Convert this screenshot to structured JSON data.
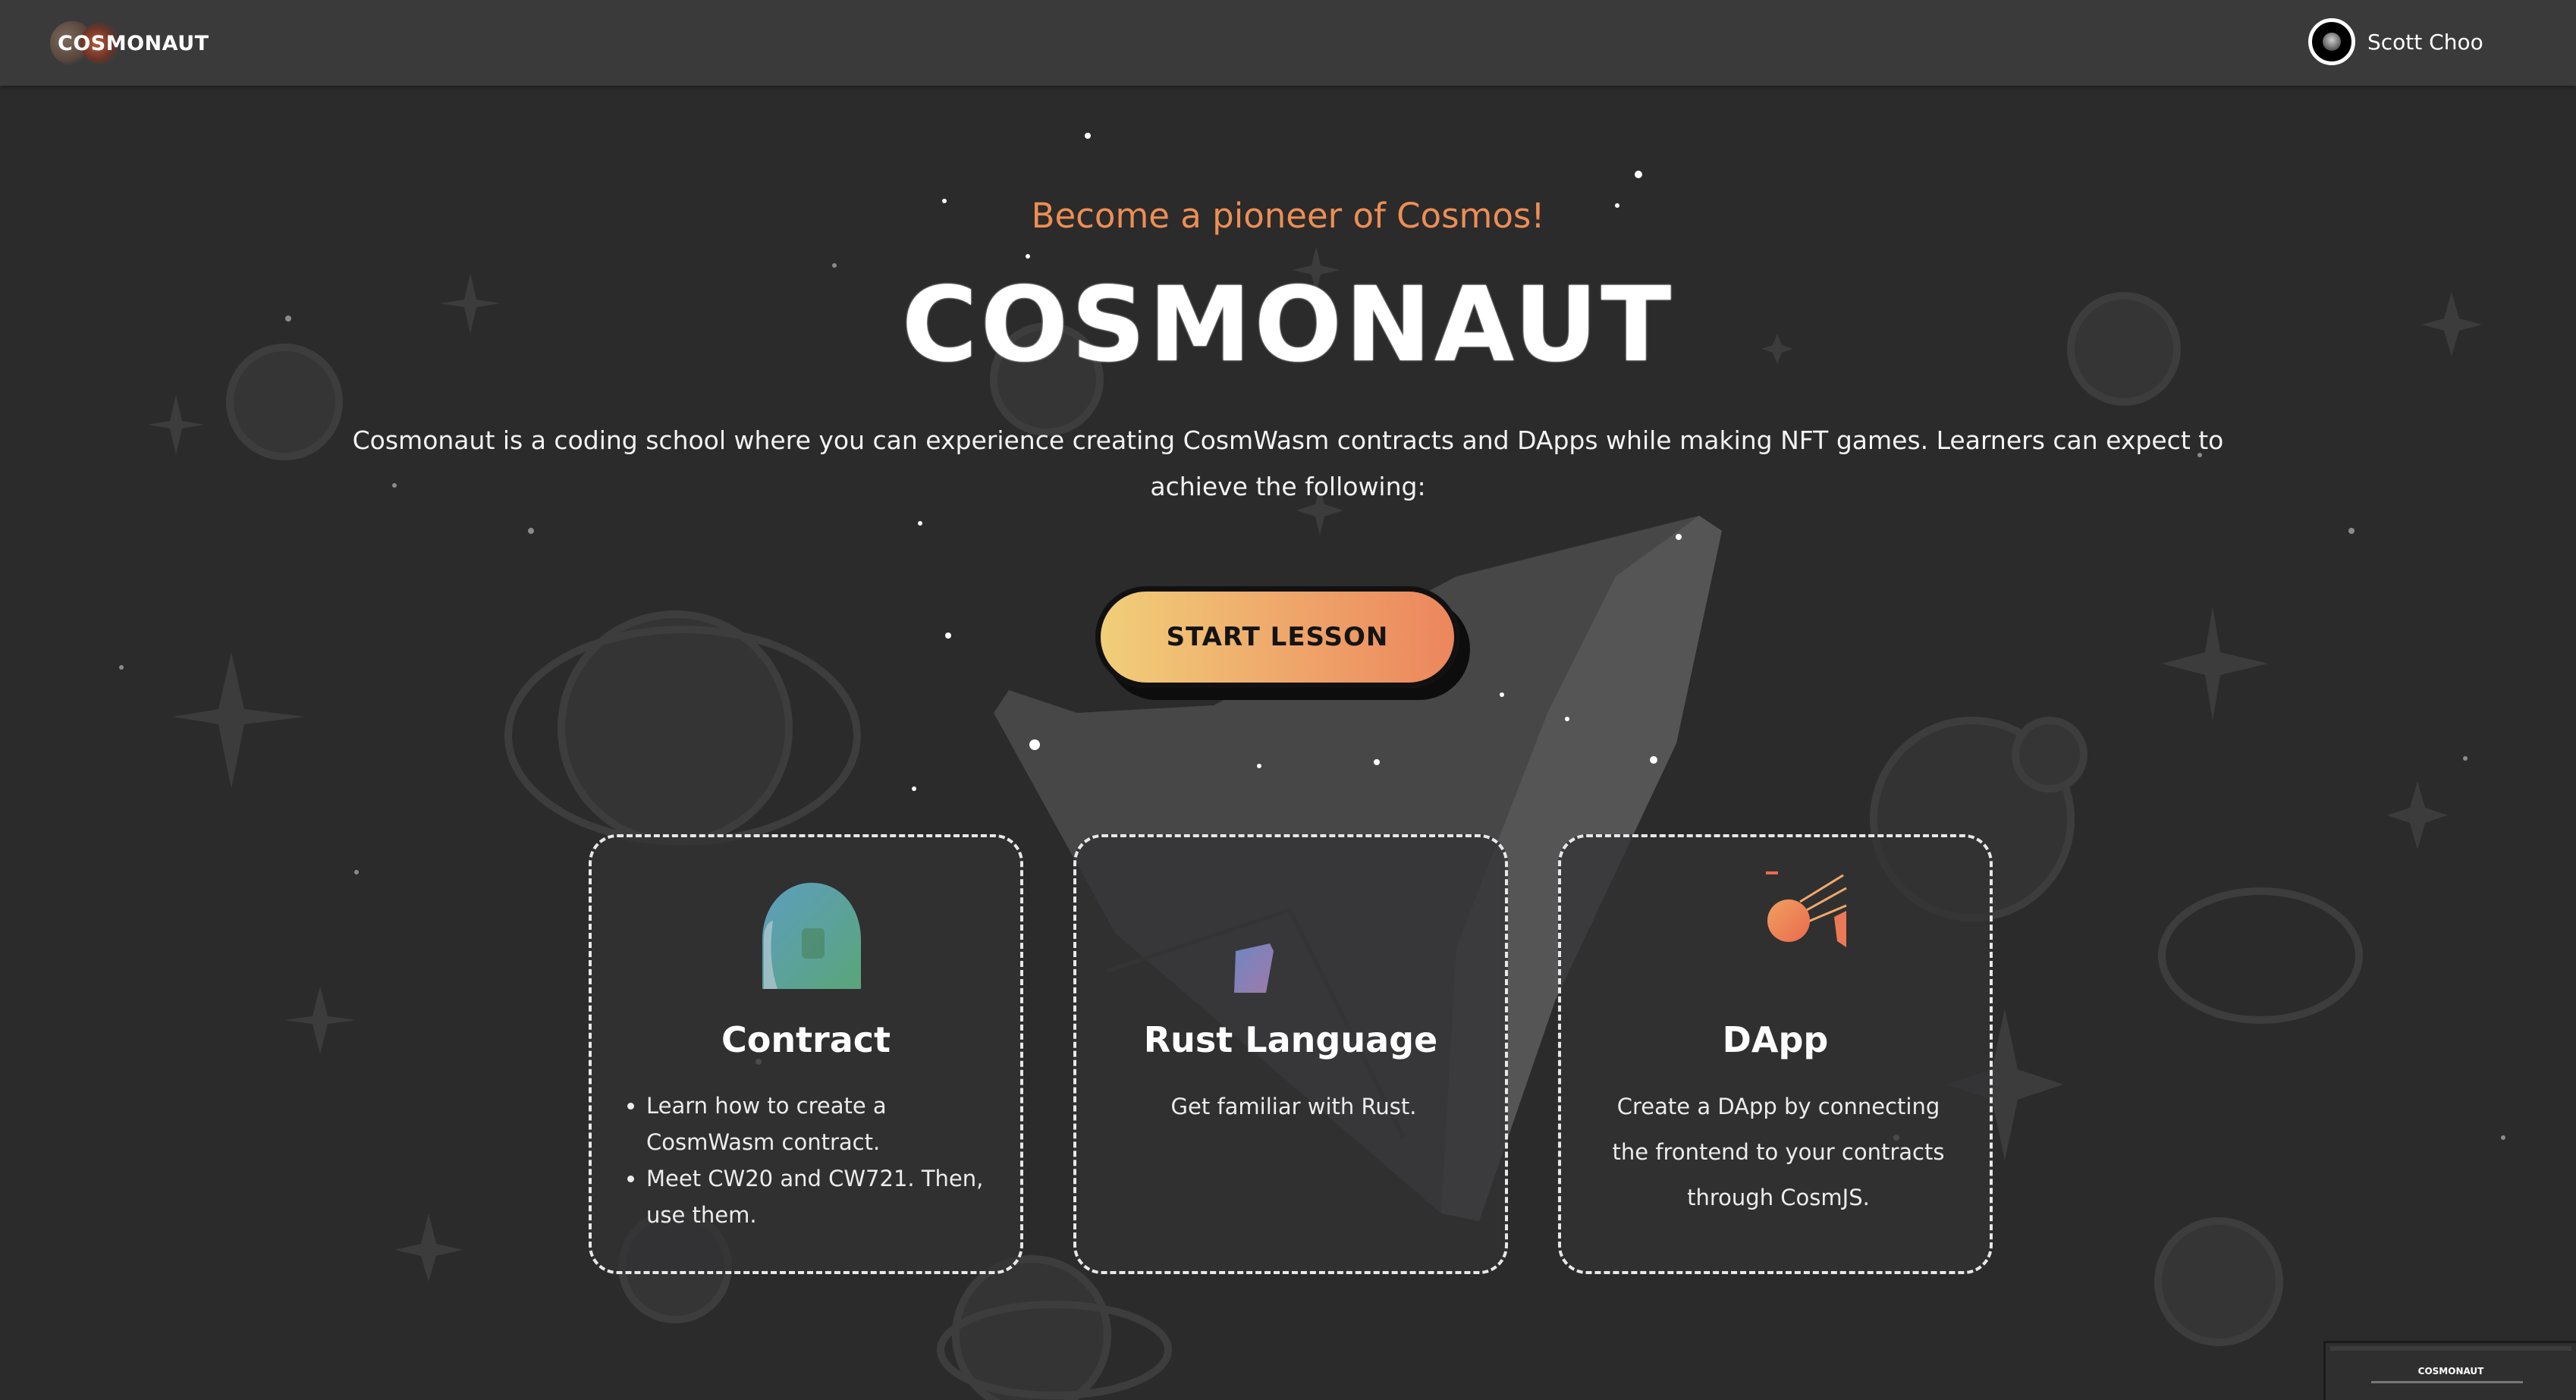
{
  "header": {
    "logo_text": "COSMONAUT",
    "user_name": "Scott Choo"
  },
  "hero": {
    "tagline": "Become a pioneer of Cosmos!",
    "title": "COSMONAUT",
    "description": "Cosmonaut is a coding school where you can experience creating CosmWasm contracts and DApps while making NFT games. Learners can expect to achieve the following:",
    "cta_label": "START LESSON"
  },
  "cards": [
    {
      "title": "Contract",
      "icon": "astronaut-helmet-icon",
      "bullets": [
        "Learn how to create a CosmWasm contract.",
        "Meet CW20 and CW721. Then, use them."
      ]
    },
    {
      "title": "Rust Language",
      "icon": "rust-shard-icon",
      "text": "Get familiar with Rust."
    },
    {
      "title": "DApp",
      "icon": "meteor-icon",
      "text": "Create a DApp by connecting the frontend to your contracts through CosmJS."
    }
  ],
  "mini_preview": {
    "title": "COSMONAUT"
  },
  "colors": {
    "background": "#2b2b2c",
    "topbar": "#3a3a3b",
    "accent_orange": "#ee8e54",
    "button_gradient_start": "#f0cf79",
    "button_gradient_end": "#ec865d"
  }
}
